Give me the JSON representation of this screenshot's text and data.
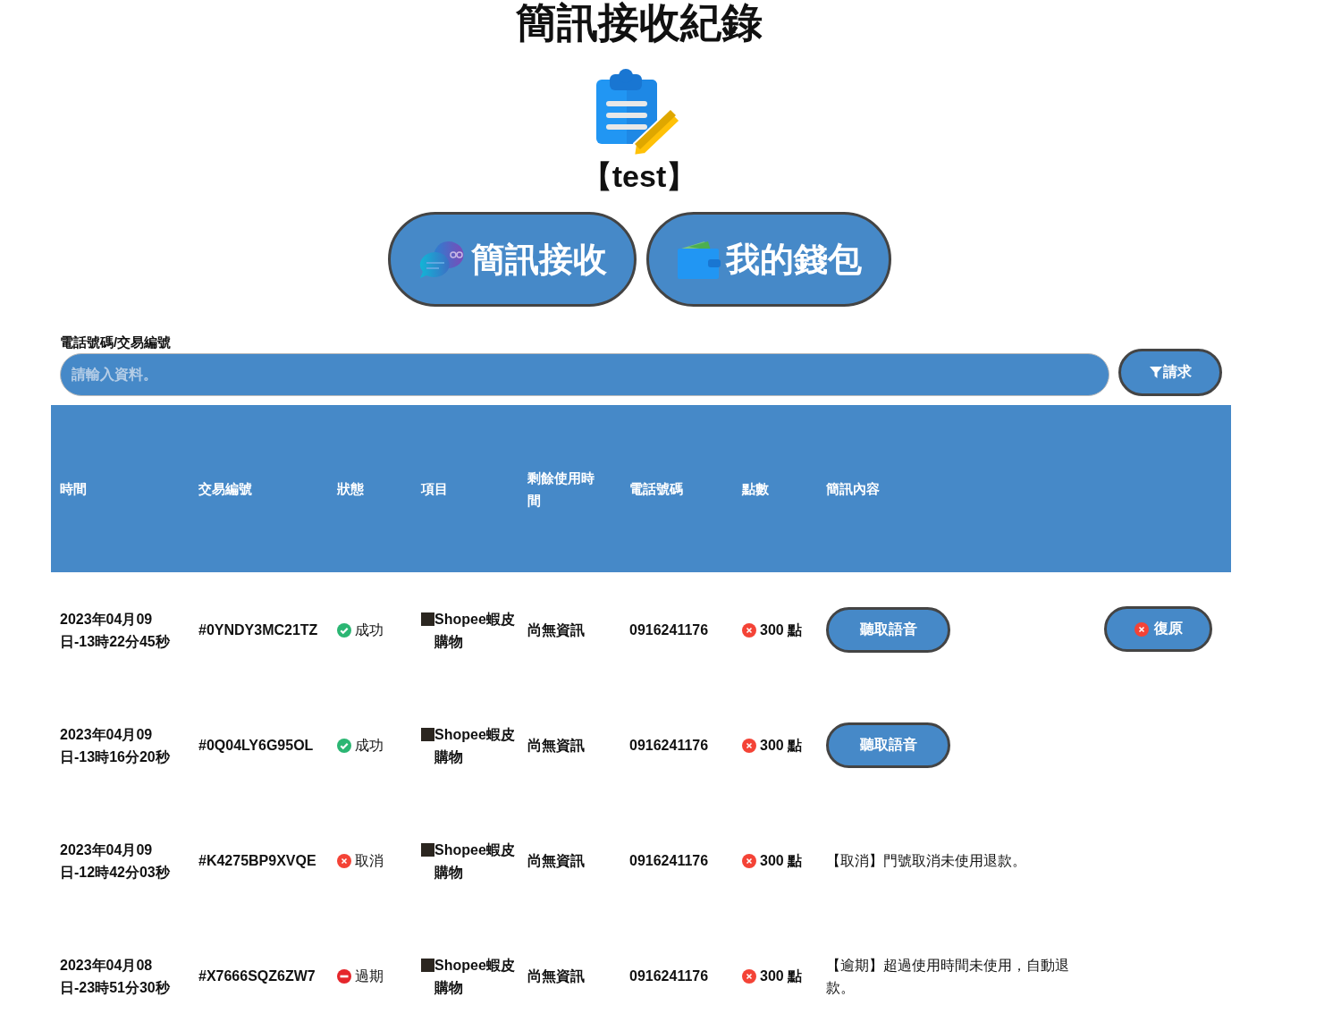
{
  "title": "簡訊接收紀錄",
  "account": "【test】",
  "nav_buttons": [
    {
      "kind": "chat",
      "label": "簡訊接收"
    },
    {
      "kind": "wallet",
      "label": "我的錢包"
    }
  ],
  "search": {
    "label": "電話號碼/交易編號",
    "placeholder": "請輸入資料。",
    "button": "請求"
  },
  "table": {
    "columns": [
      "時間",
      "交易編號",
      "狀態",
      "項目",
      "剩餘使用時間",
      "電話號碼",
      "點數",
      "簡訊內容"
    ],
    "rows": [
      {
        "time": "2023年04月09日-13時22分45秒",
        "id": "#0YNDY3MC21TZ",
        "status": {
          "kind": "success",
          "label": "成功"
        },
        "item": "Shopee蝦皮購物",
        "remaining": "尚無資訊",
        "phone": "0916241176",
        "points": "300 點",
        "content": {
          "kind": "button",
          "text": "聽取語音"
        },
        "action": "復原"
      },
      {
        "time": "2023年04月09日-13時16分20秒",
        "id": "#0Q04LY6G95OL",
        "status": {
          "kind": "success",
          "label": "成功"
        },
        "item": "Shopee蝦皮購物",
        "remaining": "尚無資訊",
        "phone": "0916241176",
        "points": "300 點",
        "content": {
          "kind": "button",
          "text": "聽取語音"
        }
      },
      {
        "time": "2023年04月09日-12時42分03秒",
        "id": "#K4275BP9XVQE",
        "status": {
          "kind": "cancel",
          "label": "取消"
        },
        "item": "Shopee蝦皮購物",
        "remaining": "尚無資訊",
        "phone": "0916241176",
        "points": "300 點",
        "content": {
          "kind": "text",
          "text": "【取消】門號取消未使用退款。"
        }
      },
      {
        "time": "2023年04月08日-23時51分30秒",
        "id": "#X7666SQZ6ZW7",
        "status": {
          "kind": "expired",
          "label": "過期"
        },
        "item": "Shopee蝦皮購物",
        "remaining": "尚無資訊",
        "phone": "0916241176",
        "points": "300 點",
        "content": {
          "kind": "text",
          "text": "【逾期】超過使用時間未使用，自動退款。"
        }
      }
    ]
  }
}
